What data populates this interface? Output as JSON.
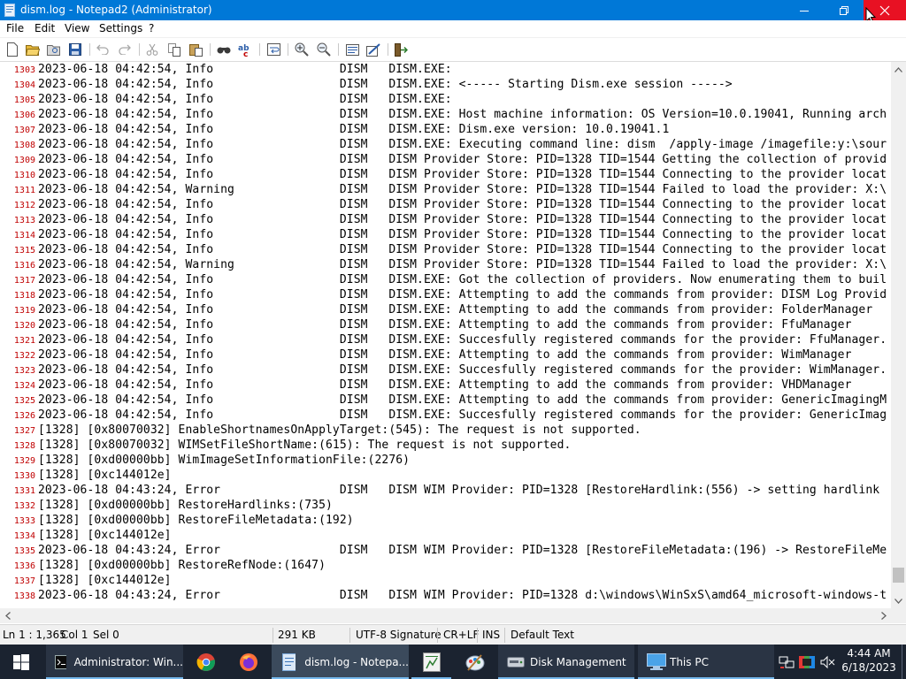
{
  "window": {
    "title": "dism.log - Notepad2 (Administrator)"
  },
  "menu": [
    "File",
    "Edit",
    "View",
    "Settings",
    "?"
  ],
  "toolbar": {
    "icons": [
      "new-icon",
      "open-icon",
      "browse-icon",
      "save-icon",
      "undo-icon",
      "redo-icon",
      "cut-icon",
      "copy-icon",
      "paste-icon",
      "find-icon",
      "replace-icon",
      "word-wrap-icon",
      "zoom-in-icon",
      "zoom-out-icon",
      "schemes-icon",
      "customize-schemes-icon",
      "exit-icon"
    ]
  },
  "editor": {
    "lines": [
      {
        "n": "1303",
        "t": "2023-06-18 04:42:54, Info                  DISM   DISM.EXE:"
      },
      {
        "n": "1304",
        "t": "2023-06-18 04:42:54, Info                  DISM   DISM.EXE: <----- Starting Dism.exe session ----->"
      },
      {
        "n": "1305",
        "t": "2023-06-18 04:42:54, Info                  DISM   DISM.EXE:"
      },
      {
        "n": "1306",
        "t": "2023-06-18 04:42:54, Info                  DISM   DISM.EXE: Host machine information: OS Version=10.0.19041, Running arch"
      },
      {
        "n": "1307",
        "t": "2023-06-18 04:42:54, Info                  DISM   DISM.EXE: Dism.exe version: 10.0.19041.1"
      },
      {
        "n": "1308",
        "t": "2023-06-18 04:42:54, Info                  DISM   DISM.EXE: Executing command line: dism  /apply-image /imagefile:y:\\sour"
      },
      {
        "n": "1309",
        "t": "2023-06-18 04:42:54, Info                  DISM   DISM Provider Store: PID=1328 TID=1544 Getting the collection of provid"
      },
      {
        "n": "1310",
        "t": "2023-06-18 04:42:54, Info                  DISM   DISM Provider Store: PID=1328 TID=1544 Connecting to the provider locat"
      },
      {
        "n": "1311",
        "t": "2023-06-18 04:42:54, Warning               DISM   DISM Provider Store: PID=1328 TID=1544 Failed to load the provider: X:\\"
      },
      {
        "n": "1312",
        "t": "2023-06-18 04:42:54, Info                  DISM   DISM Provider Store: PID=1328 TID=1544 Connecting to the provider locat"
      },
      {
        "n": "1313",
        "t": "2023-06-18 04:42:54, Info                  DISM   DISM Provider Store: PID=1328 TID=1544 Connecting to the provider locat"
      },
      {
        "n": "1314",
        "t": "2023-06-18 04:42:54, Info                  DISM   DISM Provider Store: PID=1328 TID=1544 Connecting to the provider locat"
      },
      {
        "n": "1315",
        "t": "2023-06-18 04:42:54, Info                  DISM   DISM Provider Store: PID=1328 TID=1544 Connecting to the provider locat"
      },
      {
        "n": "1316",
        "t": "2023-06-18 04:42:54, Warning               DISM   DISM Provider Store: PID=1328 TID=1544 Failed to load the provider: X:\\"
      },
      {
        "n": "1317",
        "t": "2023-06-18 04:42:54, Info                  DISM   DISM.EXE: Got the collection of providers. Now enumerating them to buil"
      },
      {
        "n": "1318",
        "t": "2023-06-18 04:42:54, Info                  DISM   DISM.EXE: Attempting to add the commands from provider: DISM Log Provid"
      },
      {
        "n": "1319",
        "t": "2023-06-18 04:42:54, Info                  DISM   DISM.EXE: Attempting to add the commands from provider: FolderManager"
      },
      {
        "n": "1320",
        "t": "2023-06-18 04:42:54, Info                  DISM   DISM.EXE: Attempting to add the commands from provider: FfuManager"
      },
      {
        "n": "1321",
        "t": "2023-06-18 04:42:54, Info                  DISM   DISM.EXE: Succesfully registered commands for the provider: FfuManager."
      },
      {
        "n": "1322",
        "t": "2023-06-18 04:42:54, Info                  DISM   DISM.EXE: Attempting to add the commands from provider: WimManager"
      },
      {
        "n": "1323",
        "t": "2023-06-18 04:42:54, Info                  DISM   DISM.EXE: Succesfully registered commands for the provider: WimManager."
      },
      {
        "n": "1324",
        "t": "2023-06-18 04:42:54, Info                  DISM   DISM.EXE: Attempting to add the commands from provider: VHDManager"
      },
      {
        "n": "1325",
        "t": "2023-06-18 04:42:54, Info                  DISM   DISM.EXE: Attempting to add the commands from provider: GenericImagingM"
      },
      {
        "n": "1326",
        "t": "2023-06-18 04:42:54, Info                  DISM   DISM.EXE: Succesfully registered commands for the provider: GenericImag"
      },
      {
        "n": "1327",
        "t": "[1328] [0x80070032] EnableShortnamesOnApplyTarget:(545): The request is not supported."
      },
      {
        "n": "1328",
        "t": "[1328] [0x80070032] WIMSetFileShortName:(615): The request is not supported."
      },
      {
        "n": "1329",
        "t": "[1328] [0xd00000bb] WimImageSetInformationFile:(2276)"
      },
      {
        "n": "1330",
        "t": "[1328] [0xc144012e]"
      },
      {
        "n": "1331",
        "t": "2023-06-18 04:43:24, Error                 DISM   DISM WIM Provider: PID=1328 [RestoreHardlink:(556) -> setting hardlink"
      },
      {
        "n": "1332",
        "t": "[1328] [0xd00000bb] RestoreHardlinks:(735)"
      },
      {
        "n": "1333",
        "t": "[1328] [0xd00000bb] RestoreFileMetadata:(192)"
      },
      {
        "n": "1334",
        "t": "[1328] [0xc144012e]"
      },
      {
        "n": "1335",
        "t": "2023-06-18 04:43:24, Error                 DISM   DISM WIM Provider: PID=1328 [RestoreFileMetadata:(196) -> RestoreFileMe"
      },
      {
        "n": "1336",
        "t": "[1328] [0xd00000bb] RestoreRefNode:(1647)"
      },
      {
        "n": "1337",
        "t": "[1328] [0xc144012e]"
      },
      {
        "n": "1338",
        "t": "2023-06-18 04:43:24, Error                 DISM   DISM WIM Provider: PID=1328 d:\\windows\\WinSxS\\amd64_microsoft-windows-t"
      }
    ]
  },
  "statusbar": {
    "position": "Ln 1 : 1,365",
    "column": "Col 1",
    "selection": "Sel 0",
    "size": "291 KB",
    "encoding": "UTF-8 Signature",
    "line_endings": "CR+LF",
    "insert_mode": "INS",
    "scheme": "Default Text"
  },
  "taskbar": {
    "items": [
      {
        "label": "Administrator: Win...",
        "icon": "cmd-icon"
      },
      {
        "label": "",
        "icon": "chrome-icon"
      },
      {
        "label": "",
        "icon": "firefox-icon"
      },
      {
        "label": "dism.log - Notepa...",
        "icon": "notepad2-icon"
      },
      {
        "label": "",
        "icon": "spreadsheet-icon"
      },
      {
        "label": "",
        "icon": "paint-icon"
      },
      {
        "label": "Disk Management",
        "icon": "disk-management-icon"
      },
      {
        "label": "This PC",
        "icon": "this-pc-icon"
      }
    ],
    "clock_time": "4:44 AM",
    "clock_date": "6/18/2023"
  },
  "colors": {
    "titlebar": "#0078d7",
    "close_hover": "#e81123",
    "line_numbers": "#c00000",
    "taskbar": "#1b2330"
  }
}
